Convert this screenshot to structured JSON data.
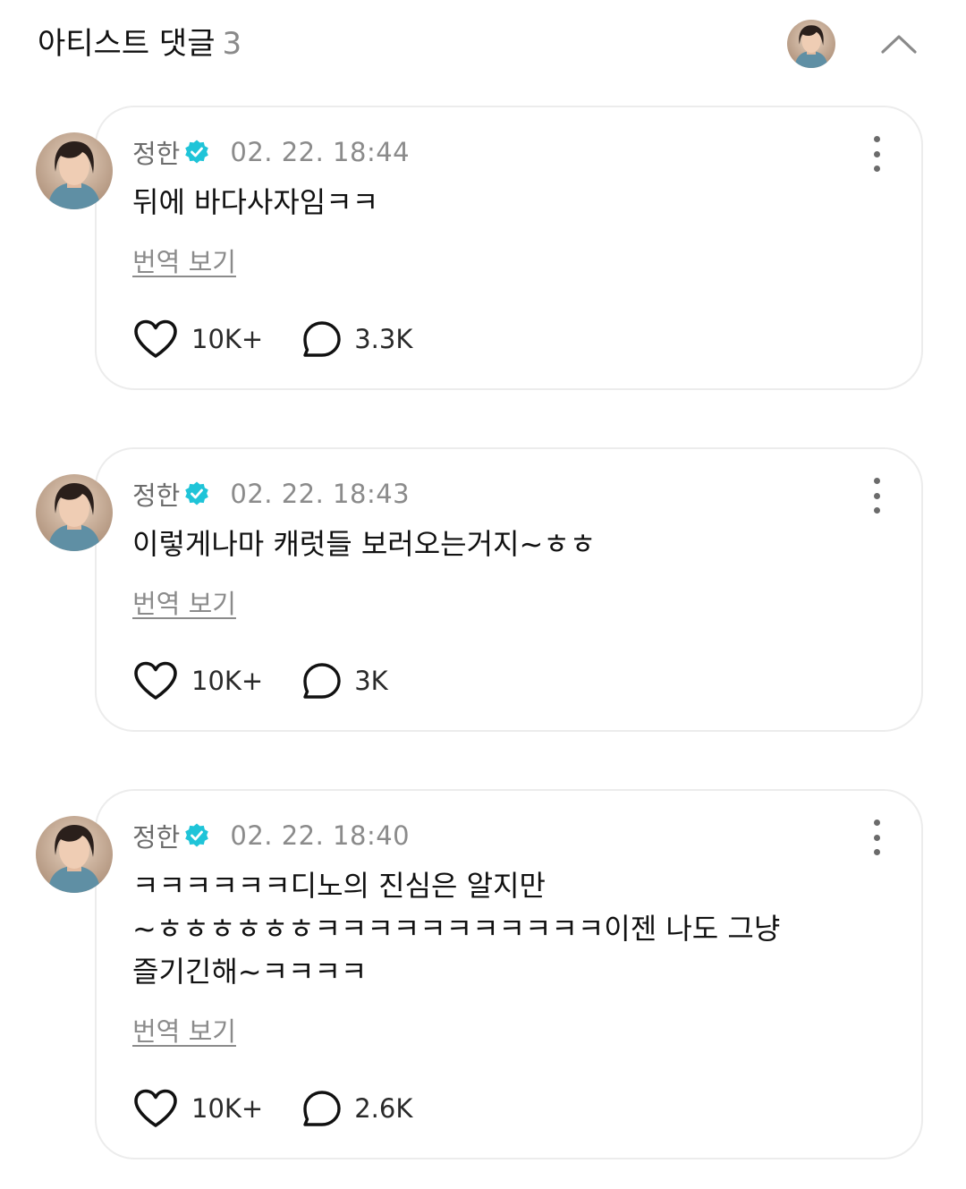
{
  "header": {
    "title": "아티스트 댓글",
    "count": "3"
  },
  "comments": [
    {
      "author": "정한",
      "time": "02. 22. 18:44",
      "text": "뒤에 바다사자임ㅋㅋ",
      "translate_label": "번역 보기",
      "likes": "10K+",
      "replies": "3.3K"
    },
    {
      "author": "정한",
      "time": "02. 22. 18:43",
      "text": "이렇게나마 캐럿들 보러오는거지~ㅎㅎ",
      "translate_label": "번역 보기",
      "likes": "10K+",
      "replies": "3K"
    },
    {
      "author": "정한",
      "time": "02. 22. 18:40",
      "text": "ㅋㅋㅋㅋㅋㅋ디노의 진심은 알지만\n~ㅎㅎㅎㅎㅎㅎㅋㅋㅋㅋㅋㅋㅋㅋㅋㅋㅋ이젠 나도 그냥\n즐기긴해~ㅋㅋㅋㅋ",
      "translate_label": "번역 보기",
      "likes": "10K+",
      "replies": "2.6K"
    }
  ],
  "icons": {
    "verified": "verified-badge-icon",
    "like": "heart-icon",
    "reply": "speech-bubble-icon",
    "more": "more-vertical-icon",
    "collapse": "chevron-up-icon"
  },
  "colors": {
    "verified": "#1fc4d8",
    "card_border": "#ececec",
    "muted_text": "#8b8b8b"
  }
}
